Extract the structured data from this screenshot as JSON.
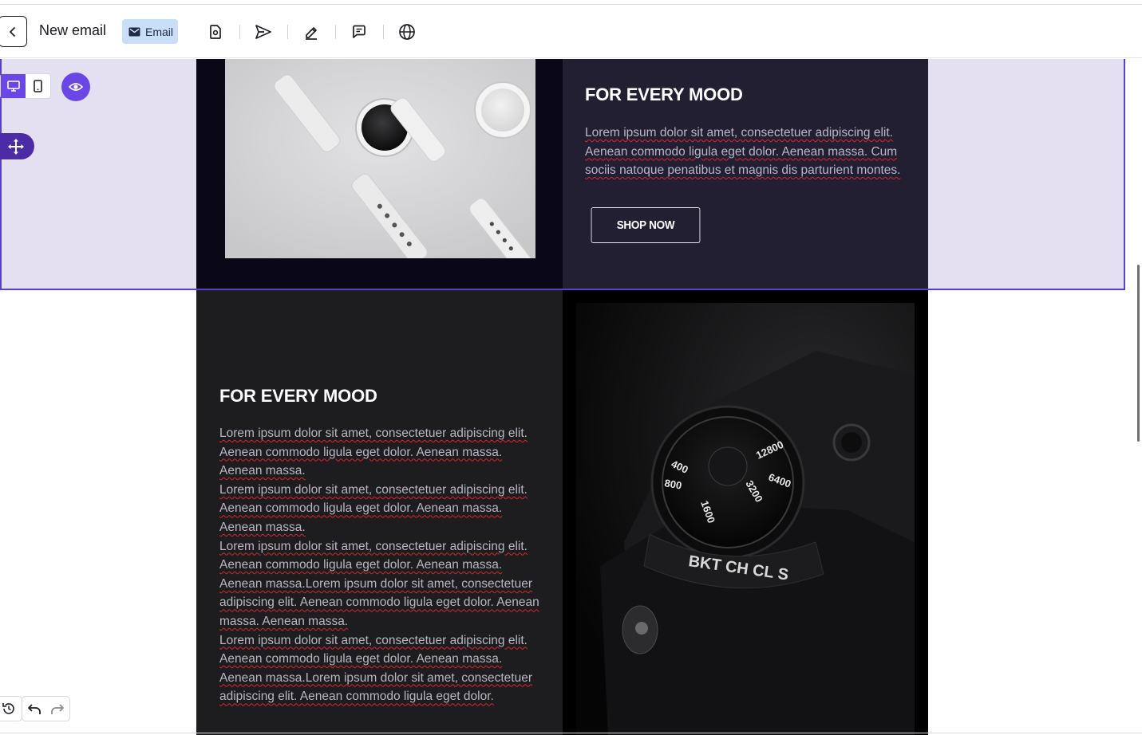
{
  "toolbar": {
    "title": "New email",
    "badge_label": "Email",
    "tools": [
      "file-settings-icon",
      "send-icon",
      "edit-pen-icon",
      "comment-icon",
      "globe-icon"
    ]
  },
  "section1": {
    "heading": "FOR EVERY MOOD",
    "paragraph": [
      "Lorem ipsum dolor sit amet, consectetuer adipiscing elit.",
      "Aenean commodo ligula eget dolor. Aenean massa. Cum",
      "sociis natoque penatibus et magnis dis parturient montes."
    ],
    "button_label": "SHOP NOW"
  },
  "section2": {
    "heading": "FOR EVERY MOOD",
    "paragraph": [
      "Lorem ipsum dolor sit amet, consectetuer adipiscing elit.",
      "Aenean commodo ligula eget dolor. Aenean massa.",
      "Aenean massa.",
      "Lorem ipsum dolor sit amet, consectetuer adipiscing elit.",
      "Aenean commodo ligula eget dolor. Aenean massa.",
      "Aenean massa.",
      "Lorem ipsum dolor sit amet, consectetuer adipiscing elit.",
      "Aenean commodo ligula eget dolor. Aenean massa.",
      "Aenean massa.Lorem ipsum dolor sit amet, consectetuer",
      "adipiscing elit. Aenean commodo ligula eget dolor. Aenean",
      "massa. Aenean massa.",
      "Lorem ipsum dolor sit amet, consectetuer adipiscing elit.",
      "Aenean commodo ligula eget dolor. Aenean massa.",
      "Aenean massa.Lorem ipsum dolor sit amet, consectetuer",
      "adipiscing elit. Aenean commodo ligula eget dolor."
    ],
    "camera_dial": [
      "400",
      "800",
      "1600",
      "3200",
      "6400",
      "12800"
    ],
    "camera_mode": "BKT CH CL S"
  },
  "colors": {
    "accent": "#6b46e6",
    "selection_bg": "#e4e0f2",
    "block1_right": "#231f33",
    "block2_left": "#1d1d1f"
  }
}
